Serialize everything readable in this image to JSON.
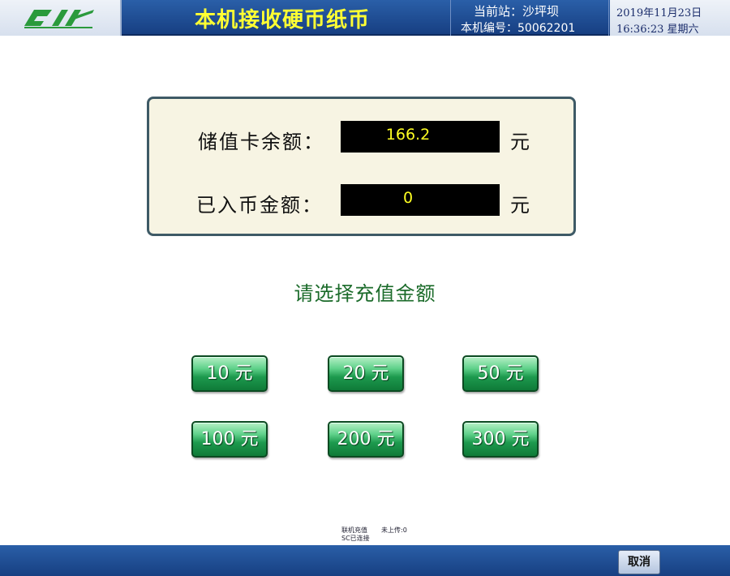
{
  "header": {
    "logo_icon": "metro-logo-icon",
    "title": "本机接收硬币纸币",
    "station": "当前站：沙坪坝",
    "machine_no": "本机编号：50062201",
    "date": "2019年11月23日",
    "time": "16:36:23 星期六",
    "colors": {
      "bar": "#1f4f97",
      "title": "#ffff33"
    }
  },
  "balance_panel": {
    "card_balance_label": "储值卡余额：",
    "card_balance_value": "166.2",
    "inserted_label": "已入币金额：",
    "inserted_value": "0",
    "unit": "元"
  },
  "prompt": "请选择充值金额",
  "amount_buttons": [
    "10 元",
    "20 元",
    "50 元",
    "100 元",
    "200 元",
    "300 元"
  ],
  "status": {
    "online_recharge": "联机充值",
    "not_uploaded": "未上传:0",
    "sc_connected": "SC已连接",
    "faint_line": "..."
  },
  "footer": {
    "cancel_label": "取消"
  }
}
